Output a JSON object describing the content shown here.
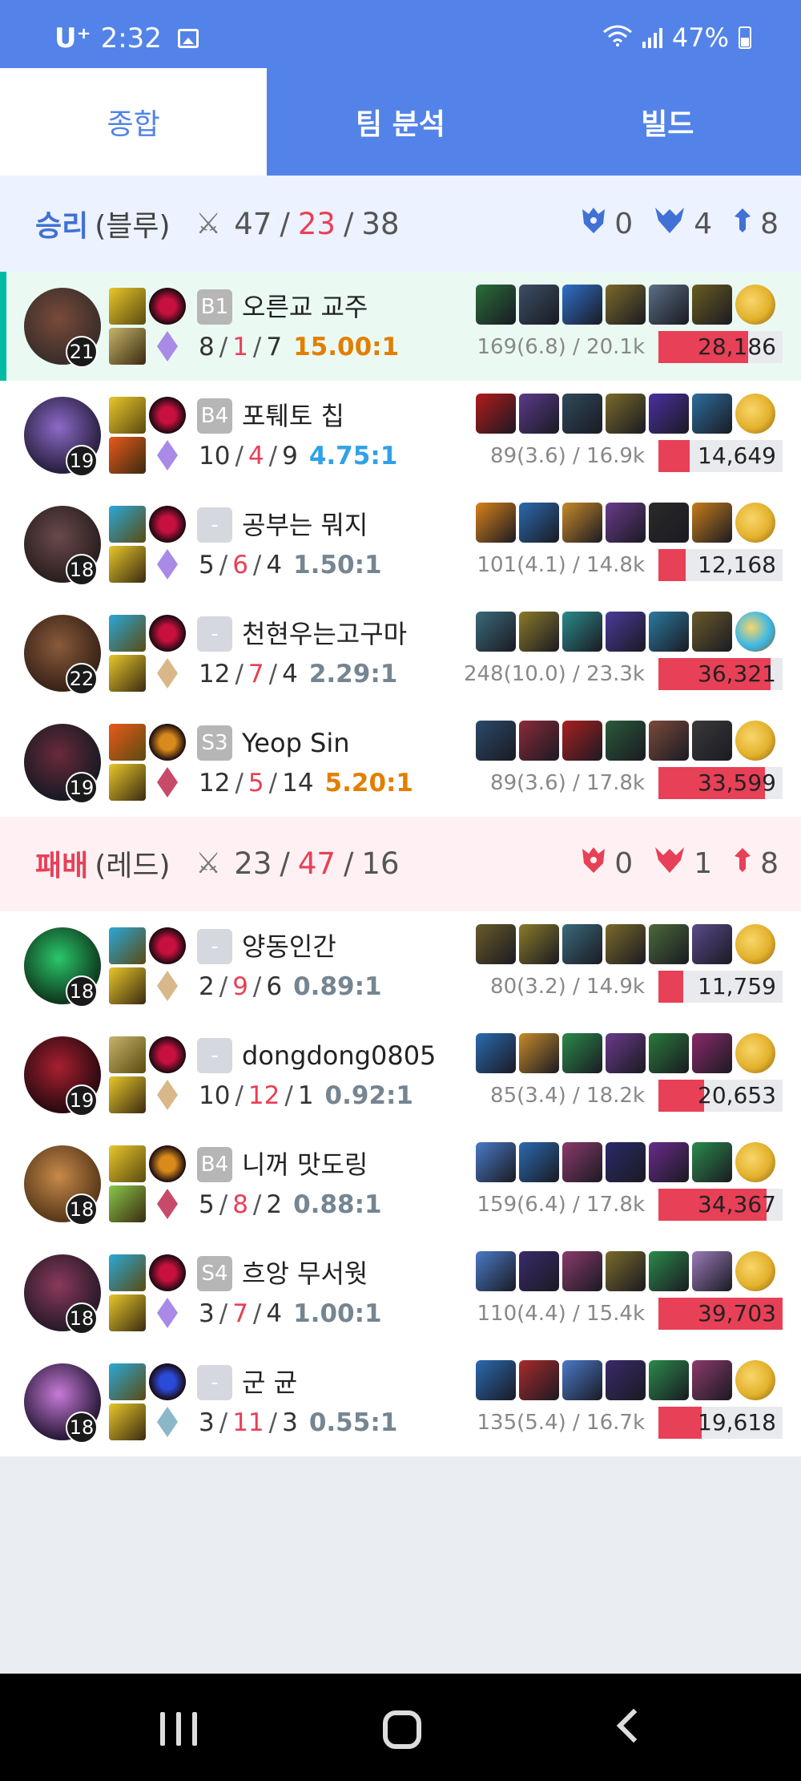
{
  "status_bar": {
    "carrier": "U⁺",
    "time": "2:32",
    "battery": "47%"
  },
  "tabs": [
    "종합",
    "팀 분석",
    "빌드"
  ],
  "teams": [
    {
      "result": "승리",
      "side": "(블루)",
      "kills": "47",
      "deaths": "23",
      "assists": "38",
      "baron": "0",
      "dragon": "4",
      "herald": "8",
      "color": "#4171d6",
      "players": [
        {
          "level": "21",
          "tier": "B1",
          "name": "오른교 교주",
          "k": "8",
          "d": "1",
          "a": "7",
          "ratio": "15.00:1",
          "ratio_color": "#e37e00",
          "cs": "169(6.8) / 20.1k",
          "damage": "28,186",
          "dmg_frac": 0.72,
          "me": true,
          "champ": [
            "#3a2e2a",
            "#7a4a3a"
          ],
          "spells": [
            "#e8c72a",
            "#c6b46a"
          ],
          "runes": [
            "#c8103f",
            "#a98ae6"
          ],
          "items": [
            "#2b6e3a",
            "#3c4e64",
            "#2f70c9",
            "#7a6a2a",
            "#5b6e83",
            "#6a5c20",
            "#e3b22d"
          ]
        },
        {
          "level": "19",
          "tier": "B4",
          "name": "포퉤토 칩",
          "k": "10",
          "d": "4",
          "a": "9",
          "ratio": "4.75:1",
          "ratio_color": "#30a2e8",
          "cs": "89(3.6) / 16.9k",
          "damage": "14,649",
          "dmg_frac": 0.25,
          "me": false,
          "champ": [
            "#2a2040",
            "#8c6ac9"
          ],
          "spells": [
            "#e8c72a",
            "#e85a1a"
          ],
          "runes": [
            "#c8103f",
            "#a98ae6"
          ],
          "items": [
            "#b11b1b",
            "#5a3a8a",
            "#2f4a5a",
            "#7a6a2a",
            "#4b2fa0",
            "#2c6e9e",
            "#e3b22d"
          ]
        },
        {
          "level": "18",
          "tier": "-",
          "name": "공부는 뭐지",
          "k": "5",
          "d": "6",
          "a": "4",
          "ratio": "1.50:1",
          "ratio_color": "#758592",
          "cs": "101(4.1) / 14.8k",
          "damage": "12,168",
          "dmg_frac": 0.22,
          "me": false,
          "champ": [
            "#2b1f20",
            "#6a4a4a"
          ],
          "spells": [
            "#2aa8d8",
            "#e8c72a"
          ],
          "runes": [
            "#c8103f",
            "#a98ae6"
          ],
          "items": [
            "#d8821a",
            "#2a6ab0",
            "#c78a2a",
            "#6a3a8a",
            "#2a2a2a",
            "#c67d1a",
            "#e3b22d"
          ]
        },
        {
          "level": "22",
          "tier": "-",
          "name": "천현우는고구마",
          "k": "12",
          "d": "7",
          "a": "4",
          "ratio": "2.29:1",
          "ratio_color": "#758592",
          "cs": "248(10.0) / 23.3k",
          "damage": "36,321",
          "dmg_frac": 0.9,
          "me": false,
          "champ": [
            "#3a2418",
            "#8a5a3a"
          ],
          "spells": [
            "#2aa8d8",
            "#e8c72a"
          ],
          "runes": [
            "#c8103f",
            "#d8b88a"
          ],
          "items": [
            "#3a6a7a",
            "#8a7a2a",
            "#2a8a8a",
            "#4a3a9a",
            "#2a7aa0",
            "#6a5a2a",
            "#3ab8e8"
          ]
        },
        {
          "level": "19",
          "tier": "S3",
          "name": "Yeop Sin",
          "k": "12",
          "d": "5",
          "a": "14",
          "ratio": "5.20:1",
          "ratio_color": "#e37e00",
          "cs": "89(3.6) / 17.8k",
          "damage": "33,599",
          "dmg_frac": 0.86,
          "me": false,
          "champ": [
            "#1a1a24",
            "#6a2a3a"
          ],
          "spells": [
            "#e85a1a",
            "#e8c72a"
          ],
          "runes": [
            "#d88a1a",
            "#c84a6a"
          ],
          "items": [
            "#2a4a6a",
            "#8a2a3a",
            "#a82020",
            "#2a5a3a",
            "#7a4a3a",
            "#3a3a3a",
            "#e3b22d"
          ]
        }
      ]
    },
    {
      "result": "패배",
      "side": "(레드)",
      "kills": "23",
      "deaths": "47",
      "assists": "16",
      "baron": "0",
      "dragon": "1",
      "herald": "8",
      "color": "#e84057",
      "players": [
        {
          "level": "18",
          "tier": "-",
          "name": "양동인간",
          "k": "2",
          "d": "9",
          "a": "6",
          "ratio": "0.89:1",
          "ratio_color": "#758592",
          "cs": "80(3.2) / 14.9k",
          "damage": "11,759",
          "dmg_frac": 0.2,
          "me": false,
          "champ": [
            "#0e3a1e",
            "#2ac86a"
          ],
          "spells": [
            "#2aa8d8",
            "#e8c72a"
          ],
          "runes": [
            "#c8103f",
            "#d8b88a"
          ],
          "items": [
            "#6a5a2a",
            "#8a7a2a",
            "#3a6a7a",
            "#7a6a2a",
            "#4a6a3a",
            "#5a4a8a",
            "#e3b22d"
          ]
        },
        {
          "level": "19",
          "tier": "-",
          "name": "dongdong0805",
          "k": "10",
          "d": "12",
          "a": "1",
          "ratio": "0.92:1",
          "ratio_color": "#758592",
          "cs": "85(3.4) / 18.2k",
          "damage": "20,653",
          "dmg_frac": 0.37,
          "me": false,
          "champ": [
            "#2a0a10",
            "#a82030"
          ],
          "spells": [
            "#c6b46a",
            "#e8c72a"
          ],
          "runes": [
            "#c8103f",
            "#d8b88a"
          ],
          "items": [
            "#2a6ab0",
            "#c78a2a",
            "#2a8a4a",
            "#6a3a8a",
            "#2a7a3a",
            "#8a2a6a",
            "#e3b22d"
          ]
        },
        {
          "level": "18",
          "tier": "B4",
          "name": "니꺼 맛도링",
          "k": "5",
          "d": "8",
          "a": "2",
          "ratio": "0.88:1",
          "ratio_color": "#758592",
          "cs": "159(6.4) / 17.8k",
          "damage": "34,367",
          "dmg_frac": 0.87,
          "me": false,
          "champ": [
            "#5a3a1a",
            "#c88a4a"
          ],
          "spells": [
            "#e8c72a",
            "#8ac84a"
          ],
          "runes": [
            "#d88a1a",
            "#c84a6a"
          ],
          "items": [
            "#4a7ac8",
            "#2a6ab0",
            "#8a3a6a",
            "#2a2a6a",
            "#6a2a8a",
            "#2a8a4a",
            "#e3b22d"
          ]
        },
        {
          "level": "18",
          "tier": "S4",
          "name": "흐앙 무서웟",
          "k": "3",
          "d": "7",
          "a": "4",
          "ratio": "1.00:1",
          "ratio_color": "#758592",
          "cs": "110(4.4) / 15.4k",
          "damage": "39,703",
          "dmg_frac": 1.0,
          "me": false,
          "champ": [
            "#2a1a2a",
            "#8a3a5a"
          ],
          "spells": [
            "#2aa8d8",
            "#e8c72a"
          ],
          "runes": [
            "#c8103f",
            "#a98ae6"
          ],
          "items": [
            "#4a7ac8",
            "#3a2a6a",
            "#8a3a6a",
            "#7a6a2a",
            "#2a8a4a",
            "#9a7ab8",
            "#e3b22d"
          ]
        },
        {
          "level": "18",
          "tier": "-",
          "name": "군 균",
          "k": "3",
          "d": "11",
          "a": "3",
          "ratio": "0.55:1",
          "ratio_color": "#758592",
          "cs": "135(5.4) / 16.7k",
          "damage": "19,618",
          "dmg_frac": 0.35,
          "me": false,
          "champ": [
            "#2a1a3a",
            "#c87ad8"
          ],
          "spells": [
            "#2aa8d8",
            "#e8c72a"
          ],
          "runes": [
            "#2a4ad8",
            "#8ab8c8"
          ],
          "items": [
            "#2a6ab0",
            "#a82a2a",
            "#4a7ac8",
            "#3a2a6a",
            "#2a8a4a",
            "#8a3a6a",
            "#e3b22d"
          ]
        }
      ]
    }
  ],
  "icons": {
    "swords": "crossed-swords-icon",
    "baron": "baron-icon",
    "dragon": "dragon-icon",
    "herald": "tower-icon"
  }
}
